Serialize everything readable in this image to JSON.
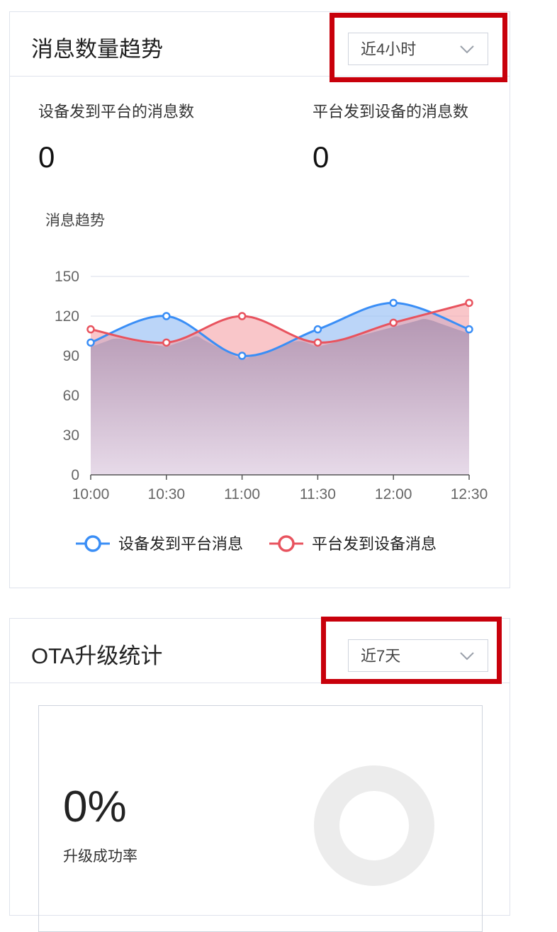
{
  "message_trend": {
    "title": "消息数量趋势",
    "range_select": {
      "value": "近4小时"
    },
    "stats": [
      {
        "label": "设备发到平台的消息数",
        "value": "0"
      },
      {
        "label": "平台发到设备的消息数",
        "value": "0"
      }
    ],
    "chart_subtitle": "消息趋势"
  },
  "chart_data": {
    "type": "area",
    "title": "消息趋势",
    "categories": [
      "10:00",
      "10:30",
      "11:00",
      "11:30",
      "12:00",
      "12:30"
    ],
    "y_ticks": [
      "0",
      "30",
      "60",
      "90",
      "120",
      "150"
    ],
    "ylim": [
      0,
      150
    ],
    "grid": true,
    "legend_position": "bottom",
    "series": [
      {
        "name": "设备发到平台消息",
        "color": "#3a8ef6",
        "values": [
          100,
          120,
          90,
          110,
          130,
          110
        ]
      },
      {
        "name": "平台发到设备消息",
        "color": "#e8535e",
        "values": [
          110,
          100,
          120,
          100,
          115,
          130
        ]
      }
    ]
  },
  "ota": {
    "title": "OTA升级统计",
    "range_select": {
      "value": "近7天"
    },
    "success_rate": {
      "value": "0%",
      "label": "升级成功率"
    }
  },
  "colors": {
    "highlight": "#c8000b",
    "blue": "#3a8ef6",
    "red": "#e8535e",
    "donut": "#ececec"
  }
}
